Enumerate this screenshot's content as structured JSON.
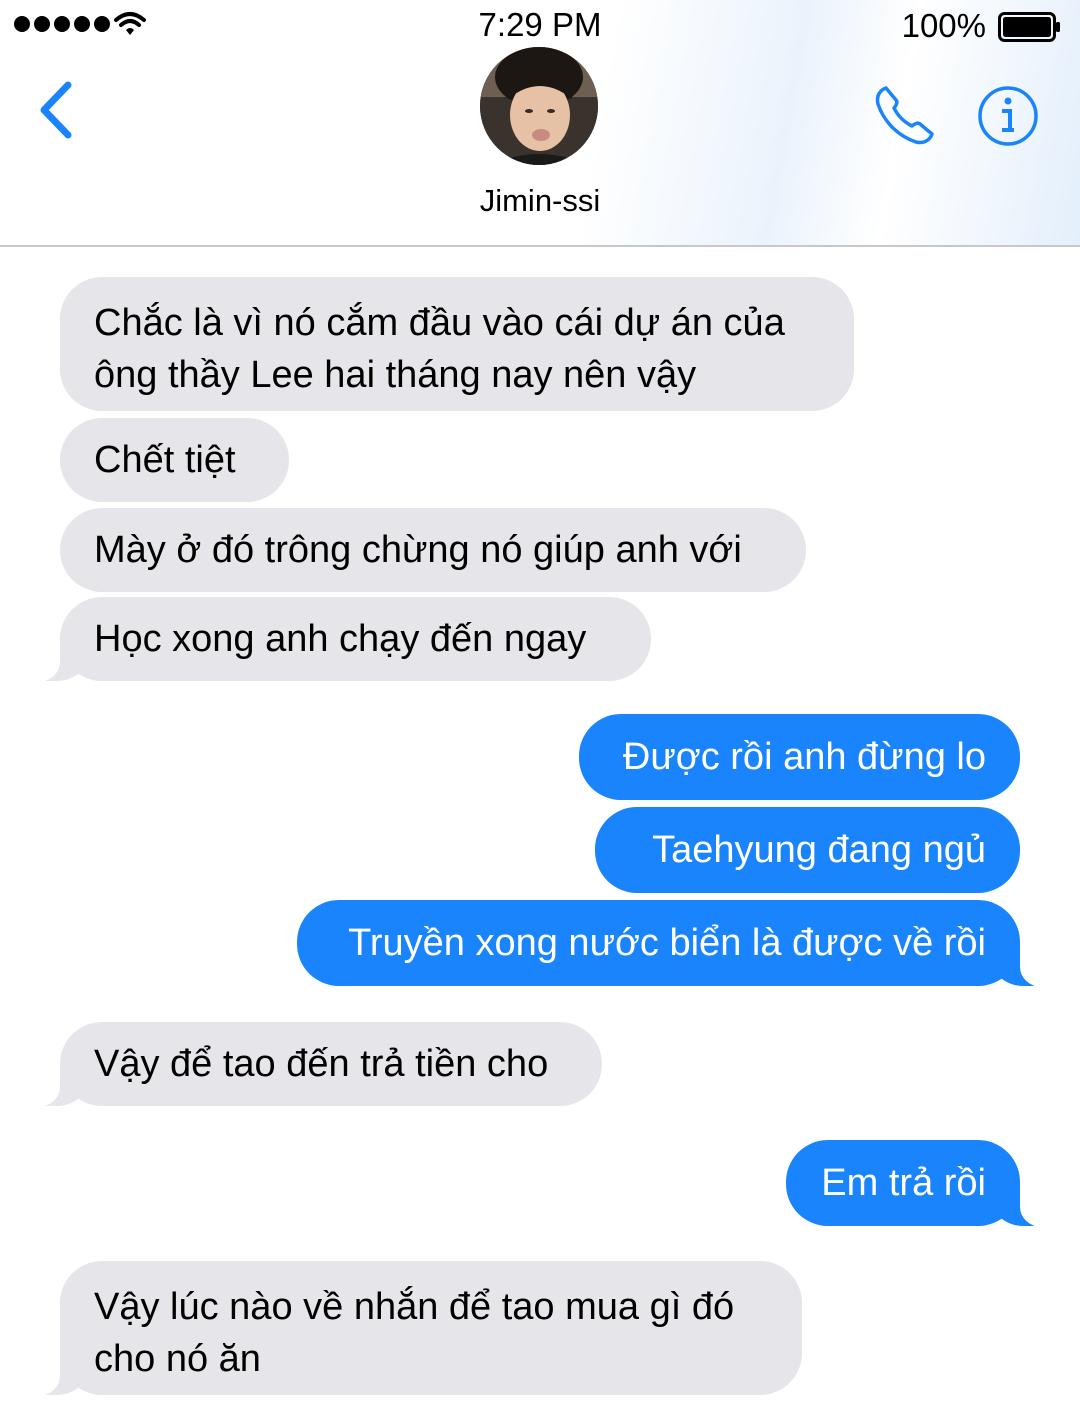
{
  "status_bar": {
    "time": "7:29 PM",
    "battery": "100%",
    "icons": [
      "signal-dots-icon",
      "wifi-icon",
      "battery-icon"
    ]
  },
  "header": {
    "contact_name": "Jimin-ssi",
    "back_icon": "chevron-left-icon",
    "call_icon": "phone-icon",
    "info_icon": "info-icon",
    "accent_color": "#1a84fc"
  },
  "messages": [
    {
      "direction": "incoming",
      "lines": [
        "Chắc là vì nó cắm đầu vào cái dự án của",
        "ông thầy Lee hai tháng nay nên vậy"
      ]
    },
    {
      "direction": "incoming",
      "text": "Chết tiệt"
    },
    {
      "direction": "incoming",
      "text": "Mày ở đó trông chừng nó giúp anh với"
    },
    {
      "direction": "incoming",
      "text": "Học xong anh chạy đến ngay"
    },
    {
      "direction": "outgoing",
      "text": "Được rồi anh đừng lo"
    },
    {
      "direction": "outgoing",
      "text": "Taehyung đang ngủ"
    },
    {
      "direction": "outgoing",
      "text": "Truyền xong nước biển là được về rồi"
    },
    {
      "direction": "incoming",
      "text": "Vậy để tao đến trả tiền cho"
    },
    {
      "direction": "outgoing",
      "text": "Em trả rồi"
    },
    {
      "direction": "incoming",
      "lines": [
        "Vậy lúc nào về nhắn để tao mua gì đó",
        "cho nó ăn"
      ]
    }
  ],
  "colors": {
    "incoming_bubble": "#e5e5ea",
    "outgoing_bubble": "#1a84fc"
  }
}
